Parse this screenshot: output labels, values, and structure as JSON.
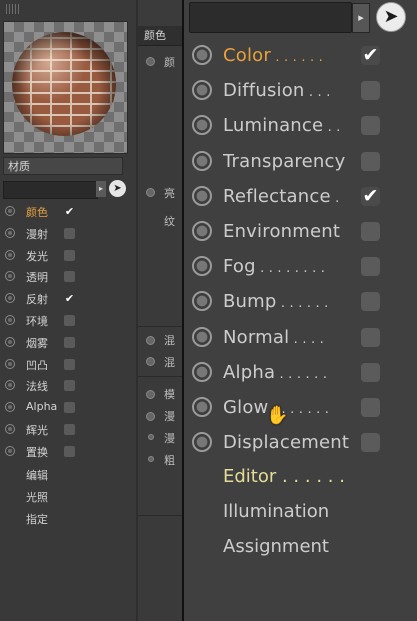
{
  "left_panel": {
    "material_name": "材质",
    "channels": [
      {
        "label": "颜色",
        "checked": true
      },
      {
        "label": "漫射",
        "checked": false
      },
      {
        "label": "发光",
        "checked": false
      },
      {
        "label": "透明",
        "checked": false
      },
      {
        "label": "反射",
        "checked": true
      },
      {
        "label": "环境",
        "checked": false
      },
      {
        "label": "烟雾",
        "checked": false
      },
      {
        "label": "凹凸",
        "checked": false
      },
      {
        "label": "法线",
        "checked": false
      },
      {
        "label": "Alpha",
        "checked": false
      },
      {
        "label": "辉光",
        "checked": false
      },
      {
        "label": "置换",
        "checked": false
      }
    ],
    "sub_items": [
      "编辑",
      "光照",
      "指定"
    ]
  },
  "middle_panel": {
    "header": "颜色",
    "texts": [
      "颜",
      "亮",
      "纹",
      "混",
      "混",
      "模",
      "漫",
      "漫",
      "粗"
    ]
  },
  "dropdown": {
    "channels": [
      {
        "label": "Color",
        "dots": " . . . . . .",
        "checked": true
      },
      {
        "label": "Diffusion",
        "dots": " . . .",
        "checked": false
      },
      {
        "label": "Luminance",
        "dots": " . .",
        "checked": false
      },
      {
        "label": "Transparency",
        "dots": "",
        "checked": false
      },
      {
        "label": "Reflectance",
        "dots": " .",
        "checked": true
      },
      {
        "label": "Environment",
        "dots": "",
        "checked": false
      },
      {
        "label": "Fog",
        "dots": " . . . . . . . .",
        "checked": false
      },
      {
        "label": "Bump",
        "dots": " . . . . . .",
        "checked": false
      },
      {
        "label": "Normal",
        "dots": " . . . .",
        "checked": false
      },
      {
        "label": "Alpha",
        "dots": " . . . . . .",
        "checked": false
      },
      {
        "label": "Glow",
        "dots": " . . . . . . .",
        "checked": false
      },
      {
        "label": "Displacement",
        "dots": "",
        "checked": false
      }
    ],
    "editor": "Editor . . . . . .",
    "illumination": "Illumination",
    "assignment": "Assignment"
  },
  "icons": {
    "check": "✔",
    "dropdown_arrow": "▸",
    "picker": "arrow-pointer-icon",
    "cursor": "hand-pointer-icon"
  },
  "colors": {
    "active_label": "#e9a13a",
    "editor_label": "#e3dd98"
  }
}
